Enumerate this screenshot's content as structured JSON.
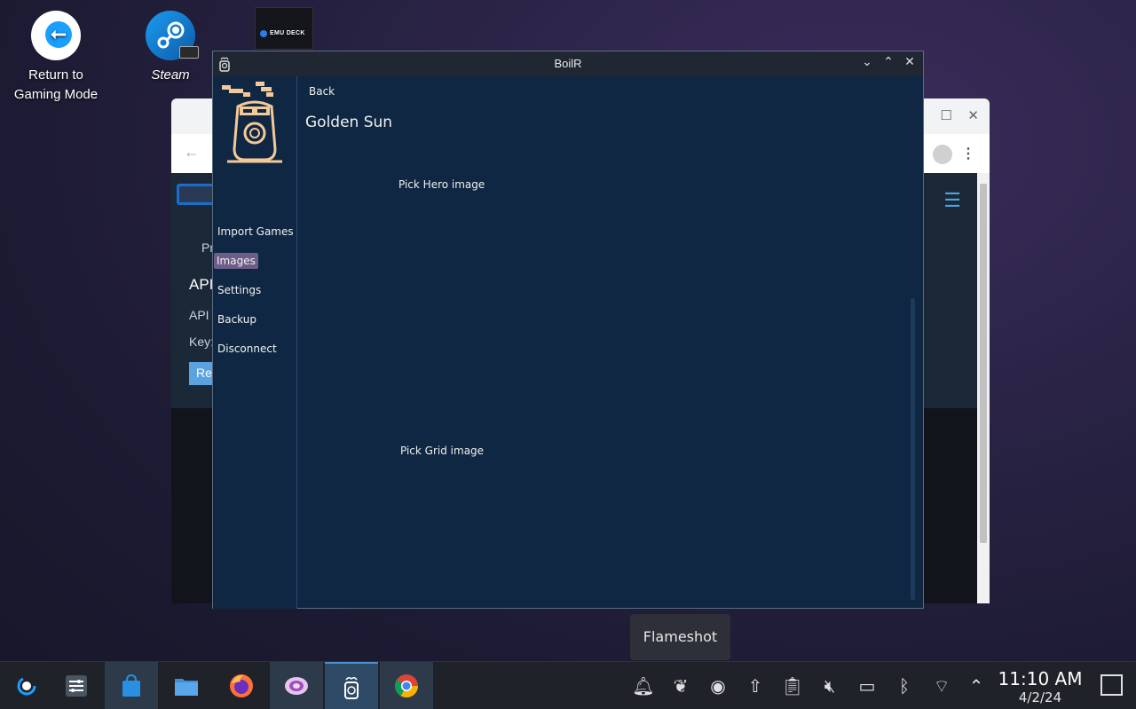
{
  "desktop": {
    "icons": [
      {
        "label_line1": "Return to",
        "label_line2": "Gaming Mode"
      },
      {
        "label": "Steam"
      },
      {
        "label": "EMU DECK"
      }
    ]
  },
  "boilr": {
    "window_title": "BoilR",
    "nav": {
      "import_games": "Import Games",
      "images": "Images",
      "settings": "Settings",
      "backup": "Backup",
      "disconnect": "Disconnect"
    },
    "back_label": "Back",
    "game_title": "Golden Sun",
    "pick_hero": "Pick Hero image",
    "pick_grid": "Pick Grid image"
  },
  "browser_fragments": {
    "pr": "Pr",
    "api_heading": "API",
    "api_text": "API",
    "key_text": "Key:",
    "btn": "Re"
  },
  "tooltip": "Flameshot",
  "taskbar": {
    "time": "11:10 AM",
    "date": "4/2/24"
  },
  "colors": {
    "boilr_bg": "#0f2742",
    "active_nav": "#6c5e88",
    "taskbar": "#1f2228",
    "steam_blue": "#1a9fff"
  }
}
